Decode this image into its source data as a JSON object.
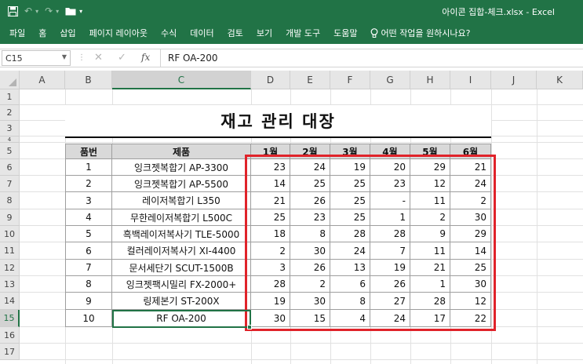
{
  "window": {
    "title": "아이콘 집합-체크.xlsx  -  Excel",
    "qat": {
      "save_icon": "save-icon",
      "undo_icon": "undo-icon",
      "redo_icon": "redo-icon",
      "open_icon": "folder-icon"
    }
  },
  "ribbon": {
    "tabs": [
      "파일",
      "홈",
      "삽입",
      "페이지 레이아웃",
      "수식",
      "데이터",
      "검토",
      "보기",
      "개발 도구",
      "도움말"
    ],
    "tell_me": "어떤 작업을 원하시나요?",
    "tell_me_icon": "lightbulb-icon"
  },
  "formula_bar": {
    "name_box": "C15",
    "content": "RF OA-200",
    "fx_label": "fx"
  },
  "columns": [
    "A",
    "B",
    "C",
    "D",
    "E",
    "F",
    "G",
    "H",
    "I",
    "J",
    "K"
  ],
  "selected_column": "C",
  "rows": [
    "1",
    "2",
    "3",
    "4",
    "5",
    "6",
    "7",
    "8",
    "9",
    "10",
    "11",
    "12",
    "13",
    "14",
    "15",
    "16",
    "17"
  ],
  "selected_row": "15",
  "sheet": {
    "title": "재고 관리 대장",
    "headers": [
      "품번",
      "제품",
      "1월",
      "2월",
      "3월",
      "4월",
      "5월",
      "6월"
    ],
    "records": [
      [
        "1",
        "잉크젯복합기 AP-3300",
        "23",
        "24",
        "19",
        "20",
        "29",
        "21"
      ],
      [
        "2",
        "잉크젯복합기 AP-5500",
        "14",
        "25",
        "25",
        "23",
        "12",
        "24"
      ],
      [
        "3",
        "레이저복합기 L350",
        "21",
        "26",
        "25",
        "-",
        "11",
        "2"
      ],
      [
        "4",
        "무한레이저복합기 L500C",
        "25",
        "23",
        "25",
        "1",
        "2",
        "30"
      ],
      [
        "5",
        "흑백레이저복사기 TLE-5000",
        "18",
        "8",
        "28",
        "28",
        "9",
        "29"
      ],
      [
        "6",
        "컬러레이저복사기 XI-4400",
        "2",
        "30",
        "24",
        "7",
        "11",
        "14"
      ],
      [
        "7",
        "문서세단기 SCUT-1500B",
        "3",
        "26",
        "13",
        "19",
        "21",
        "25"
      ],
      [
        "8",
        "잉크젯팩시밀리 FX-2000+",
        "28",
        "2",
        "6",
        "26",
        "1",
        "30"
      ],
      [
        "9",
        "링제본기 ST-200X",
        "19",
        "30",
        "8",
        "27",
        "28",
        "12"
      ],
      [
        "10",
        "RF OA-200",
        "30",
        "15",
        "4",
        "24",
        "17",
        "22"
      ]
    ]
  },
  "colors": {
    "excel_green": "#217346",
    "highlight_red": "#e0232a",
    "header_fill": "#d9d9d9"
  }
}
